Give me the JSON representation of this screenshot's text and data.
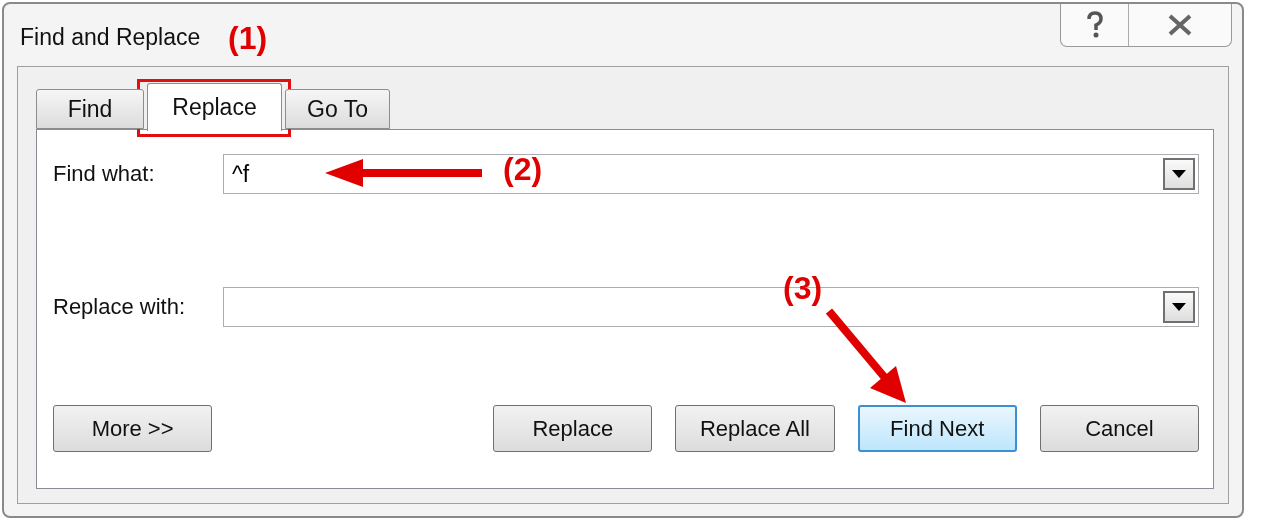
{
  "window": {
    "title": "Find and Replace"
  },
  "tabs": [
    {
      "label": "Find",
      "selected": false
    },
    {
      "label": "Replace",
      "selected": true
    },
    {
      "label": "Go To",
      "selected": false
    }
  ],
  "fields": [
    {
      "label": "Find what:",
      "value": "^f"
    },
    {
      "label": "Replace with:"
    }
  ],
  "buttons": [
    {
      "label": "More >>",
      "focused": false
    },
    {
      "label": "Replace",
      "focused": false
    },
    {
      "label": "Replace All",
      "focused": false
    },
    {
      "label": "Find Next",
      "focused": true
    },
    {
      "label": "Cancel",
      "focused": false
    }
  ],
  "callouts": [
    "(1)",
    "(2)",
    "(3)"
  ]
}
